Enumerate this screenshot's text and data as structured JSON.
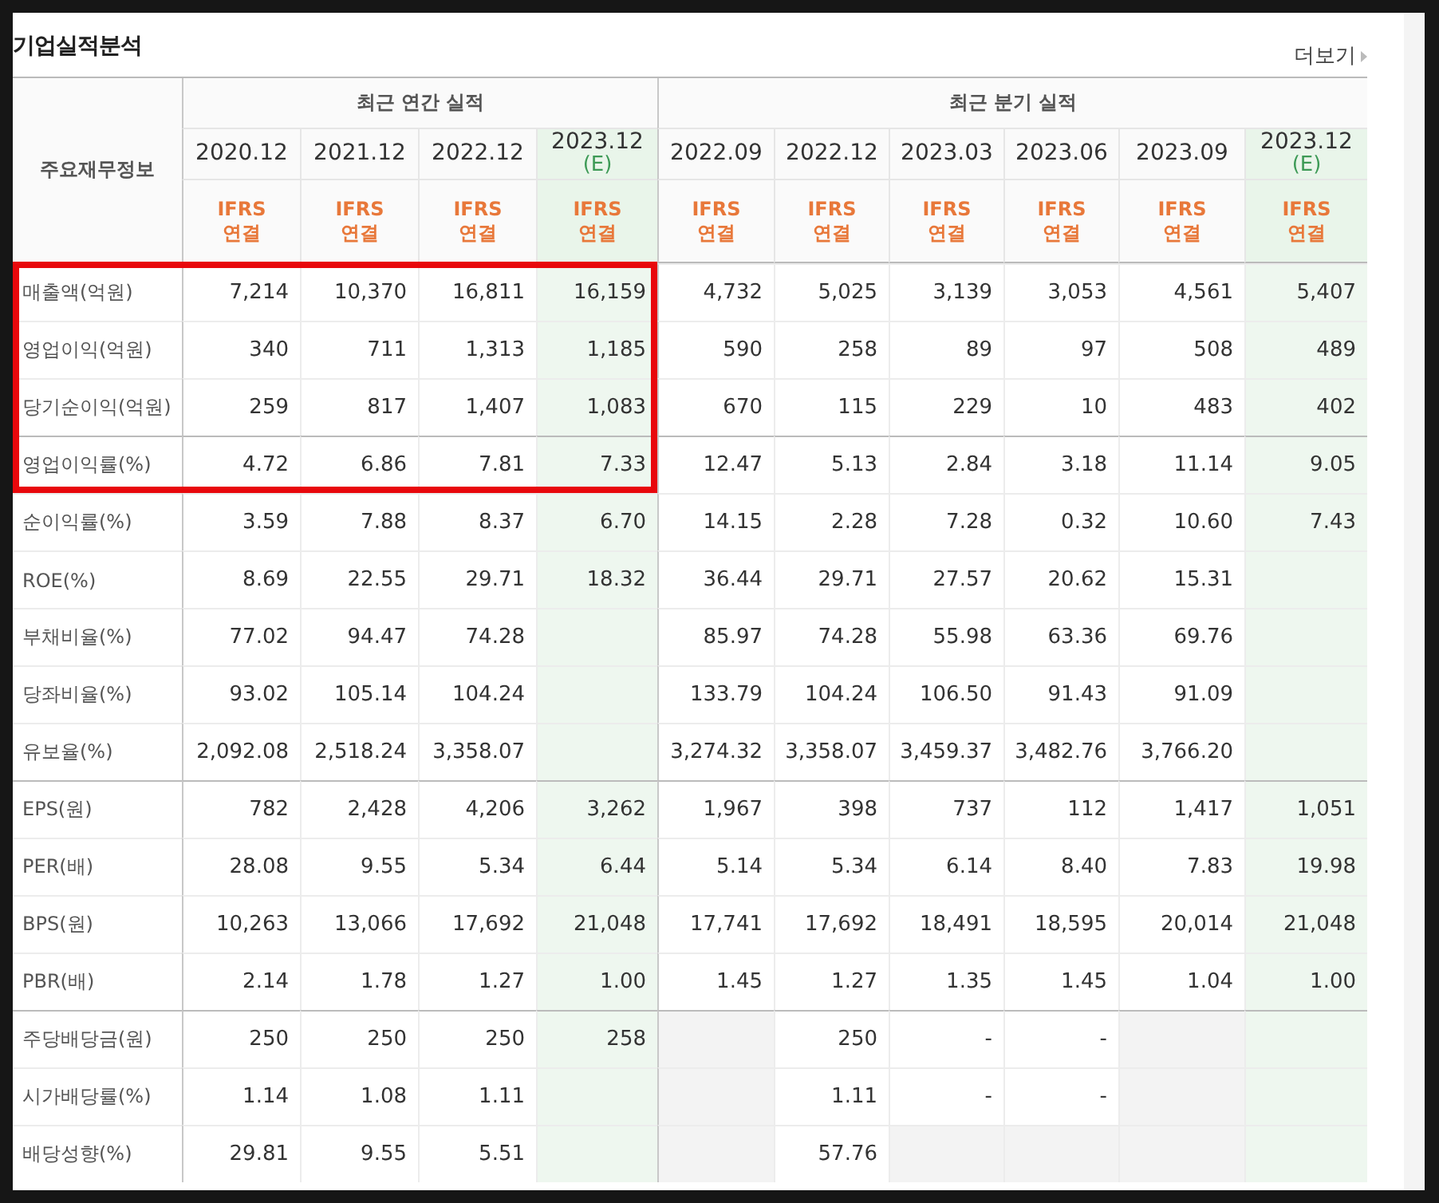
{
  "section": {
    "title": "기업실적분석",
    "more_link": "더보기"
  },
  "table": {
    "corner_header": "주요재무정보",
    "column_groups": [
      {
        "title": "최근 연간 실적",
        "highlighted": true,
        "columns": [
          {
            "period": "2020.12",
            "estimate": false,
            "standard": "IFRS",
            "scope": "연결"
          },
          {
            "period": "2021.12",
            "estimate": false,
            "standard": "IFRS",
            "scope": "연결"
          },
          {
            "period": "2022.12",
            "estimate": false,
            "standard": "IFRS",
            "scope": "연결"
          },
          {
            "period": "2023.12",
            "estimate": true,
            "estimate_mark": "(E)",
            "standard": "IFRS",
            "scope": "연결"
          }
        ]
      },
      {
        "title": "최근 분기 실적",
        "highlighted": false,
        "columns": [
          {
            "period": "2022.09",
            "estimate": false,
            "standard": "IFRS",
            "scope": "연결"
          },
          {
            "period": "2022.12",
            "estimate": false,
            "standard": "IFRS",
            "scope": "연결"
          },
          {
            "period": "2023.03",
            "estimate": false,
            "standard": "IFRS",
            "scope": "연결"
          },
          {
            "period": "2023.06",
            "estimate": false,
            "standard": "IFRS",
            "scope": "연결"
          },
          {
            "period": "2023.09",
            "estimate": false,
            "standard": "IFRS",
            "scope": "연결"
          },
          {
            "period": "2023.12",
            "estimate": true,
            "estimate_mark": "(E)",
            "standard": "IFRS",
            "scope": "연결"
          }
        ]
      }
    ],
    "row_groups": [
      {
        "rows": [
          {
            "label": "매출액(억원)",
            "highlighted": true,
            "cells": [
              {
                "text": "7,214"
              },
              {
                "text": "10,370"
              },
              {
                "text": "16,811"
              },
              {
                "text": "16,159"
              },
              {
                "text": "4,732"
              },
              {
                "text": "5,025"
              },
              {
                "text": "3,139"
              },
              {
                "text": "3,053"
              },
              {
                "text": "4,561"
              },
              {
                "text": "5,407"
              }
            ]
          },
          {
            "label": "영업이익(억원)",
            "highlighted": true,
            "cells": [
              {
                "text": "340"
              },
              {
                "text": "711"
              },
              {
                "text": "1,313"
              },
              {
                "text": "1,185"
              },
              {
                "text": "590"
              },
              {
                "text": "258"
              },
              {
                "text": "89"
              },
              {
                "text": "97"
              },
              {
                "text": "508"
              },
              {
                "text": "489"
              }
            ]
          },
          {
            "label": "당기순이익(억원)",
            "highlighted": true,
            "cells": [
              {
                "text": "259"
              },
              {
                "text": "817"
              },
              {
                "text": "1,407"
              },
              {
                "text": "1,083"
              },
              {
                "text": "670"
              },
              {
                "text": "115"
              },
              {
                "text": "229"
              },
              {
                "text": "10"
              },
              {
                "text": "483"
              },
              {
                "text": "402"
              }
            ]
          }
        ]
      },
      {
        "rows": [
          {
            "label": "영업이익률(%)",
            "highlighted": true,
            "cells": [
              {
                "text": "4.72"
              },
              {
                "text": "6.86"
              },
              {
                "text": "7.81"
              },
              {
                "text": "7.33"
              },
              {
                "text": "12.47"
              },
              {
                "text": "5.13"
              },
              {
                "text": "2.84"
              },
              {
                "text": "3.18"
              },
              {
                "text": "11.14"
              },
              {
                "text": "9.05"
              }
            ]
          },
          {
            "label": "순이익률(%)",
            "highlighted": false,
            "cells": [
              {
                "text": "3.59"
              },
              {
                "text": "7.88"
              },
              {
                "text": "8.37"
              },
              {
                "text": "6.70"
              },
              {
                "text": "14.15"
              },
              {
                "text": "2.28"
              },
              {
                "text": "7.28"
              },
              {
                "text": "0.32"
              },
              {
                "text": "10.60"
              },
              {
                "text": "7.43"
              }
            ]
          },
          {
            "label": "ROE(%)",
            "highlighted": false,
            "cells": [
              {
                "text": "8.69"
              },
              {
                "text": "22.55"
              },
              {
                "text": "29.71"
              },
              {
                "text": "18.32"
              },
              {
                "text": "36.44"
              },
              {
                "text": "29.71"
              },
              {
                "text": "27.57"
              },
              {
                "text": "20.62"
              },
              {
                "text": "15.31"
              },
              {
                "blank": true
              }
            ]
          },
          {
            "label": "부채비율(%)",
            "highlighted": false,
            "cells": [
              {
                "text": "77.02"
              },
              {
                "text": "94.47"
              },
              {
                "text": "74.28"
              },
              {
                "blank": true
              },
              {
                "text": "85.97"
              },
              {
                "text": "74.28"
              },
              {
                "text": "55.98"
              },
              {
                "text": "63.36"
              },
              {
                "text": "69.76"
              },
              {
                "blank": true
              }
            ]
          },
          {
            "label": "당좌비율(%)",
            "highlighted": false,
            "cells": [
              {
                "text": "93.02"
              },
              {
                "text": "105.14"
              },
              {
                "text": "104.24"
              },
              {
                "blank": true
              },
              {
                "text": "133.79"
              },
              {
                "text": "104.24"
              },
              {
                "text": "106.50"
              },
              {
                "text": "91.43"
              },
              {
                "text": "91.09"
              },
              {
                "blank": true
              }
            ]
          },
          {
            "label": "유보율(%)",
            "highlighted": false,
            "cells": [
              {
                "text": "2,092.08"
              },
              {
                "text": "2,518.24"
              },
              {
                "text": "3,358.07"
              },
              {
                "blank": true
              },
              {
                "text": "3,274.32"
              },
              {
                "text": "3,358.07"
              },
              {
                "text": "3,459.37"
              },
              {
                "text": "3,482.76"
              },
              {
                "text": "3,766.20"
              },
              {
                "blank": true
              }
            ]
          }
        ]
      },
      {
        "rows": [
          {
            "label": "EPS(원)",
            "highlighted": false,
            "cells": [
              {
                "text": "782"
              },
              {
                "text": "2,428"
              },
              {
                "text": "4,206"
              },
              {
                "text": "3,262"
              },
              {
                "text": "1,967"
              },
              {
                "text": "398"
              },
              {
                "text": "737"
              },
              {
                "text": "112"
              },
              {
                "text": "1,417"
              },
              {
                "text": "1,051"
              }
            ]
          },
          {
            "label": "PER(배)",
            "highlighted": false,
            "cells": [
              {
                "text": "28.08"
              },
              {
                "text": "9.55"
              },
              {
                "text": "5.34"
              },
              {
                "text": "6.44"
              },
              {
                "text": "5.14"
              },
              {
                "text": "5.34"
              },
              {
                "text": "6.14"
              },
              {
                "text": "8.40"
              },
              {
                "text": "7.83"
              },
              {
                "text": "19.98"
              }
            ]
          },
          {
            "label": "BPS(원)",
            "highlighted": false,
            "cells": [
              {
                "text": "10,263"
              },
              {
                "text": "13,066"
              },
              {
                "text": "17,692"
              },
              {
                "text": "21,048"
              },
              {
                "text": "17,741"
              },
              {
                "text": "17,692"
              },
              {
                "text": "18,491"
              },
              {
                "text": "18,595"
              },
              {
                "text": "20,014"
              },
              {
                "text": "21,048"
              }
            ]
          },
          {
            "label": "PBR(배)",
            "highlighted": false,
            "cells": [
              {
                "text": "2.14"
              },
              {
                "text": "1.78"
              },
              {
                "text": "1.27"
              },
              {
                "text": "1.00"
              },
              {
                "text": "1.45"
              },
              {
                "text": "1.27"
              },
              {
                "text": "1.35"
              },
              {
                "text": "1.45"
              },
              {
                "text": "1.04"
              },
              {
                "text": "1.00"
              }
            ]
          }
        ]
      },
      {
        "rows": [
          {
            "label": "주당배당금(원)",
            "highlighted": false,
            "cells": [
              {
                "text": "250"
              },
              {
                "text": "250"
              },
              {
                "text": "250"
              },
              {
                "text": "258"
              },
              {
                "blank": true
              },
              {
                "text": "250"
              },
              {
                "text": "-"
              },
              {
                "text": "-"
              },
              {
                "blank": true
              },
              {
                "blank": true
              }
            ]
          },
          {
            "label": "시가배당률(%)",
            "highlighted": false,
            "cells": [
              {
                "text": "1.14"
              },
              {
                "text": "1.08"
              },
              {
                "text": "1.11"
              },
              {
                "blank": true
              },
              {
                "blank": true
              },
              {
                "text": "1.11"
              },
              {
                "text": "-"
              },
              {
                "text": "-"
              },
              {
                "blank": true
              },
              {
                "blank": true
              }
            ]
          },
          {
            "label": "배당성향(%)",
            "highlighted": false,
            "cells": [
              {
                "text": "29.81"
              },
              {
                "text": "9.55"
              },
              {
                "text": "5.51"
              },
              {
                "blank": true
              },
              {
                "blank": true
              },
              {
                "text": "57.76"
              },
              {
                "blank": true
              },
              {
                "blank": true
              },
              {
                "blank": true
              },
              {
                "blank": true
              }
            ]
          }
        ]
      }
    ]
  }
}
